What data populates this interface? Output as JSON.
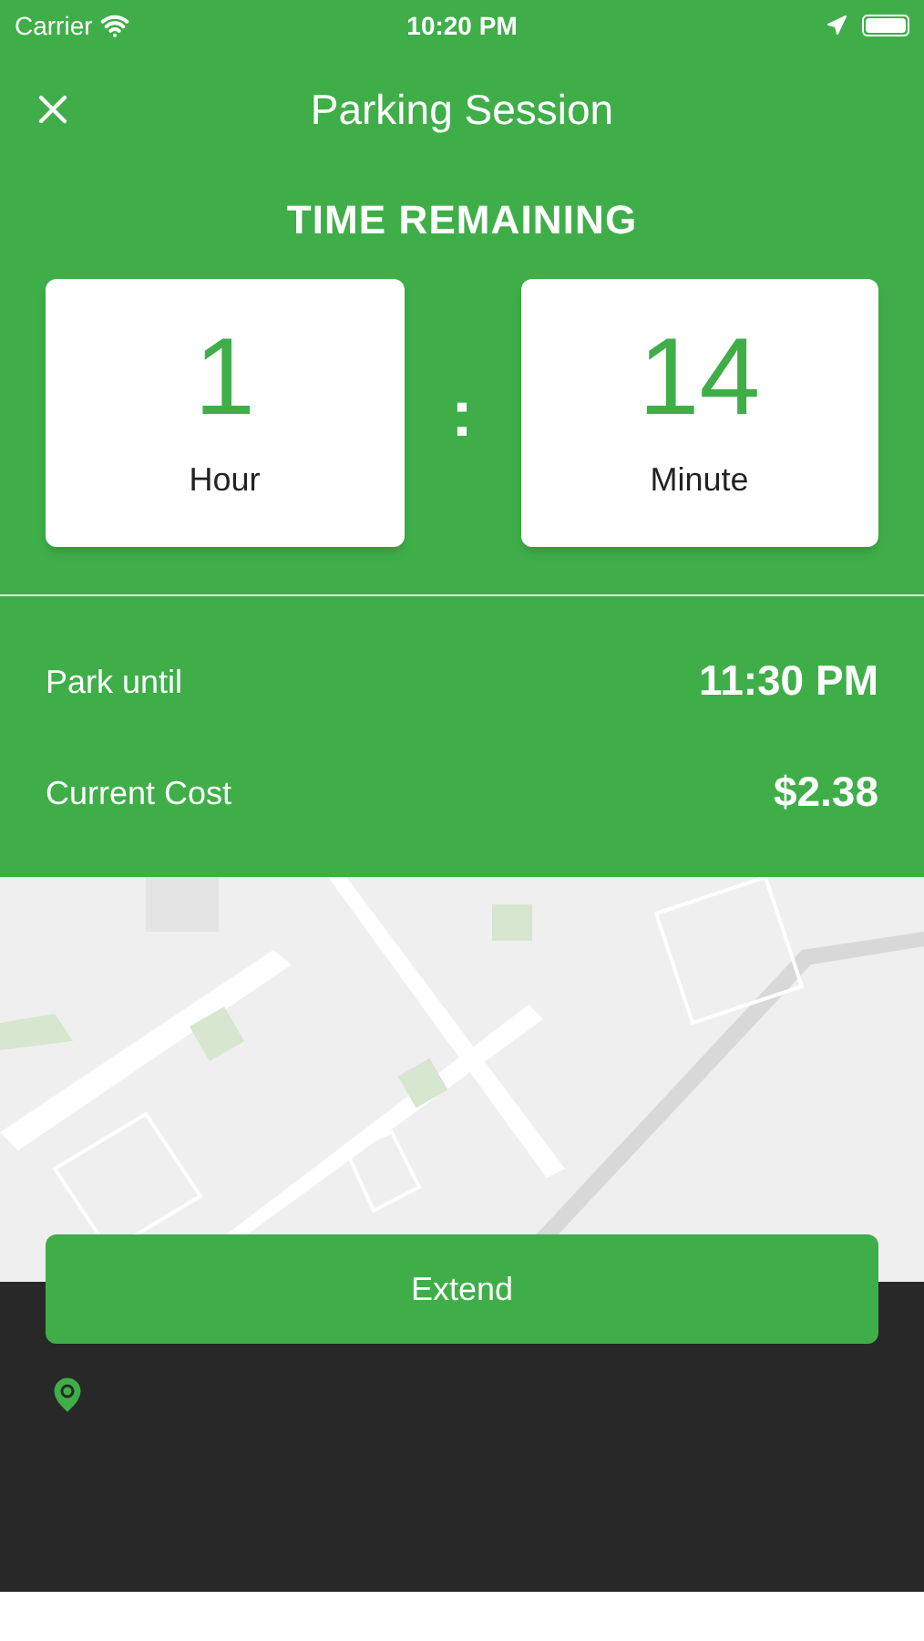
{
  "status_bar": {
    "carrier": "Carrier",
    "time": "10:20 PM"
  },
  "header": {
    "title": "Parking Session"
  },
  "timer": {
    "heading": "TIME REMAINING",
    "separator": ":",
    "units": [
      {
        "value": "1",
        "label": "Hour"
      },
      {
        "value": "14",
        "label": "Minute"
      }
    ]
  },
  "details": [
    {
      "label": "Park until",
      "value": "11:30 PM"
    },
    {
      "label": "Current Cost",
      "value": "$2.38"
    }
  ],
  "extend_button": {
    "label": "Extend"
  }
}
